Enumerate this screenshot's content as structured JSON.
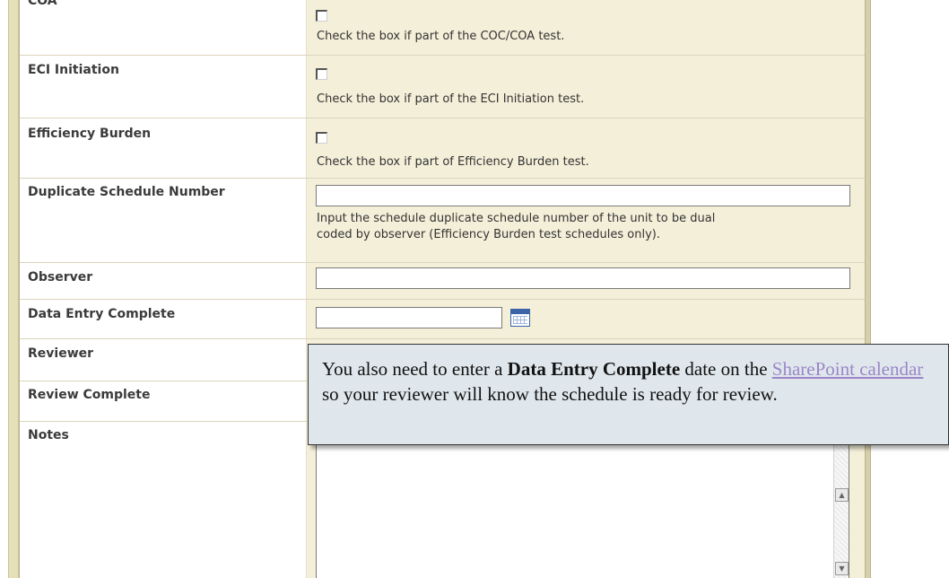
{
  "form": {
    "rows": [
      {
        "label": "COA",
        "help": "Check the box if part of the COC/COA test."
      },
      {
        "label": "ECI Initiation",
        "help": "Check the box if part of the ECI Initiation test."
      },
      {
        "label": "Efficiency Burden",
        "help": "Check the box if part of Efficiency Burden test."
      },
      {
        "label": "Duplicate Schedule Number",
        "help_line1": "Input the schedule duplicate schedule number of the unit to be dual",
        "help_line2": "coded by observer (Efficiency Burden test schedules only)."
      },
      {
        "label": "Observer"
      },
      {
        "label": "Data Entry Complete"
      },
      {
        "label": "Reviewer"
      },
      {
        "label": "Review Complete"
      },
      {
        "label": "Notes"
      }
    ]
  },
  "callout": {
    "text_1": "You also need to enter a ",
    "bold": "Data Entry Complete",
    "text_2": " date on the ",
    "link": "SharePoint calendar",
    "text_3": " so your reviewer will know the schedule is ready for review."
  },
  "icons": {
    "calendar": "calendar-icon",
    "scroll_up": "scroll-up-arrow-icon",
    "scroll_down": "scroll-down-arrow-icon"
  },
  "colors": {
    "value_background": "#f4efd9",
    "callout_background": "#dfe7ec",
    "link": "#9b86c7",
    "frame_accent": "#e6e0b8"
  }
}
